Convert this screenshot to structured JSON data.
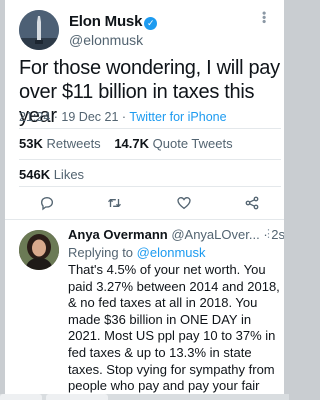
{
  "tweet": {
    "author_name": "Elon Musk",
    "author_handle": "@elonmusk",
    "text": "For those wondering, I will pay over $11 billion in taxes this year",
    "time": "21:24",
    "date": "19 Dec 21",
    "separator": "·",
    "client": "Twitter for iPhone",
    "retweets_count": "53K",
    "retweets_label": "Retweets",
    "quotes_count": "14.7K",
    "quotes_label": "Quote Tweets",
    "likes_count": "546K",
    "likes_label": "Likes"
  },
  "reply": {
    "author_name": "Anya Overmann",
    "author_handle": "@AnyaLOver...",
    "separator": "·",
    "age": "2s",
    "replying_prefix": "Replying to",
    "replying_to": "@elonmusk",
    "text": "That's 4.5% of your net worth. You paid 3.27% between 2014 and 2018, & no fed taxes at all in 2018. You made $36 billion in ONE DAY in 2021. Most US ppl pay 10 to 37% in fed taxes & up to 13.3% in state taxes. Stop vying for sympathy from people who pay and pay your fair share."
  },
  "icons": {
    "verified": "verified-badge-icon",
    "more": "more-dots-icon",
    "reply": "reply-icon",
    "retweet": "retweet-icon",
    "like": "heart-icon",
    "share": "share-icon"
  },
  "colors": {
    "accent": "#1d9bf0",
    "text": "#0f1419",
    "muted": "#536471",
    "border": "#e4e8eb"
  }
}
